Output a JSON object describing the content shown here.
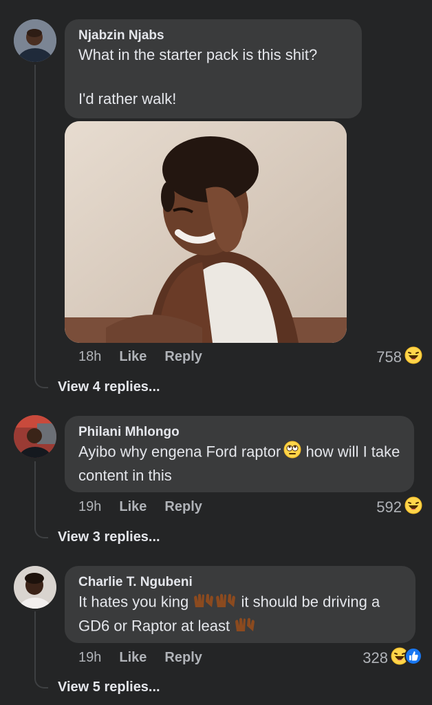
{
  "comments": [
    {
      "author": "Njabzin Njabs",
      "text_line1": "What in the starter pack is this shit?",
      "text_line2": "I'd rather walk!",
      "time": "18h",
      "like_label": "Like",
      "reply_label": "Reply",
      "reaction_count": "758",
      "view_replies": "View 4 replies...",
      "reactions": [
        "haha-icon"
      ]
    },
    {
      "author": "Philani Mhlongo",
      "text_part1": "Ayibo why engena Ford raptor",
      "text_part2": " how will I take content in this",
      "time": "19h",
      "like_label": "Like",
      "reply_label": "Reply",
      "reaction_count": "592",
      "view_replies": "View 3 replies...",
      "reactions": [
        "haha-icon"
      ]
    },
    {
      "author": "Charlie T. Ngubeni",
      "text_part1": "It hates you king",
      "text_part2": " it should be driving a GD6 or Raptor at least",
      "time": "19h",
      "like_label": "Like",
      "reply_label": "Reply",
      "reaction_count": "328",
      "view_replies": "View 5 replies...",
      "reactions": [
        "haha-icon",
        "like-icon"
      ]
    }
  ],
  "colors": {
    "background": "#242526",
    "bubble": "#3a3b3c",
    "text": "#e4e6eb",
    "secondary": "#b0b3b8",
    "like_blue": "#1877f2",
    "haha_yellow": "#ffd54a"
  }
}
